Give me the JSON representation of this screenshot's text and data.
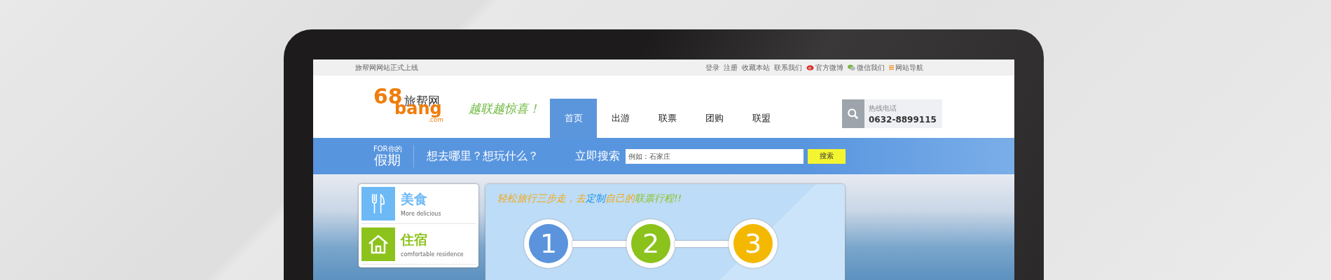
{
  "top_bar": {
    "notice": "旅帮网网站正式上线",
    "links": [
      {
        "label": "登录",
        "kind": "text"
      },
      {
        "label": "注册",
        "kind": "text"
      },
      {
        "label": "收藏本站",
        "kind": "text"
      },
      {
        "label": "联系我们",
        "kind": "text"
      },
      {
        "label": "官方微博",
        "kind": "weibo"
      },
      {
        "label": "微信我们",
        "kind": "wechat"
      },
      {
        "label": "网站导航",
        "kind": "menu"
      }
    ]
  },
  "logo": {
    "digits": "68",
    "word": "bang",
    "name": "旅帮网",
    "domain": ".com"
  },
  "slogan": "越联越惊喜！",
  "nav": [
    {
      "label": "首页",
      "selected": true
    },
    {
      "label": "出游",
      "selected": false
    },
    {
      "label": "联票",
      "selected": false
    },
    {
      "label": "团购",
      "selected": false
    },
    {
      "label": "联盟",
      "selected": false
    }
  ],
  "hotline": {
    "label": "热线电话",
    "number": "0632-8899115"
  },
  "search_bar": {
    "tag_small": "FOR你的",
    "tag_big": "假期",
    "question": "想去哪里？想玩什么？",
    "cta": "立即搜索",
    "placeholder": "例如：石家庄",
    "button": "搜索"
  },
  "categories": [
    {
      "title": "美食",
      "subtitle": "More delicious",
      "kind": "food",
      "color": "#6cb9f6"
    },
    {
      "title": "住宿",
      "subtitle": "comfortable residence",
      "kind": "home",
      "color": "#8cc21c"
    }
  ],
  "steps_panel": {
    "headline": [
      {
        "text": "轻松旅行三步走，去",
        "color": "#f5a70c"
      },
      {
        "text": "定制",
        "color": "#1f93e0"
      },
      {
        "text": "自己的",
        "color": "#f5a70c"
      },
      {
        "text": "联票行程!!",
        "color": "#8cc21c"
      }
    ],
    "steps": [
      {
        "number": "1",
        "color": "#5b94dc"
      },
      {
        "number": "2",
        "color": "#8cc21c"
      },
      {
        "number": "3",
        "color": "#f4b800"
      }
    ]
  }
}
